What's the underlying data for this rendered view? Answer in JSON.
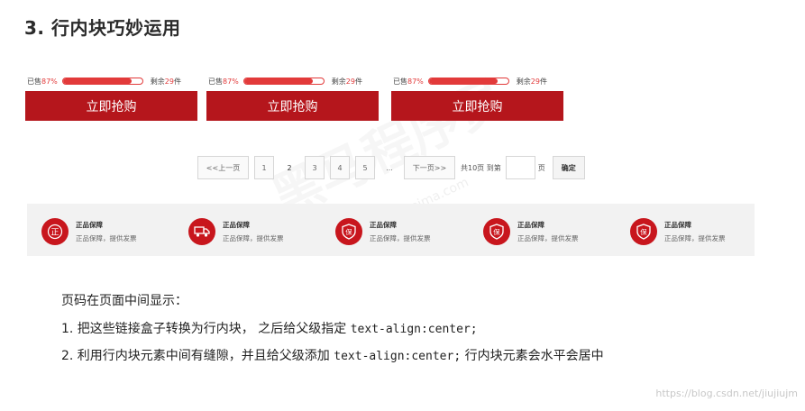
{
  "title": "3. 行内块巧妙运用",
  "cards": [
    {
      "sold_label": "已售",
      "sold_pct": "87%",
      "progress": 0.87,
      "remain_label": "剩余",
      "remain_num": "29",
      "remain_unit": "件",
      "button": "立即抢购"
    },
    {
      "sold_label": "已售",
      "sold_pct": "87%",
      "progress": 0.87,
      "remain_label": "剩余",
      "remain_num": "29",
      "remain_unit": "件",
      "button": "立即抢购"
    },
    {
      "sold_label": "已售",
      "sold_pct": "87%",
      "progress": 0.87,
      "remain_label": "剩余",
      "remain_num": "29",
      "remain_unit": "件",
      "button": "立即抢购"
    }
  ],
  "pagination": {
    "prev": "<<上一页",
    "pages": [
      "1",
      "2",
      "3",
      "4",
      "5"
    ],
    "current": "2",
    "ellipsis": "...",
    "next": "下一页>>",
    "total_text": "共10页 到第",
    "page_unit": "页",
    "confirm": "确定"
  },
  "guarantees": [
    {
      "icon": "zheng-seal-icon",
      "glyph": "正",
      "title": "正品保障",
      "desc": "正品保障，提供发票"
    },
    {
      "icon": "delivery-truck-icon",
      "glyph": "🚚",
      "title": "正品保障",
      "desc": "正品保障，提供发票"
    },
    {
      "icon": "bao-shield-icon",
      "glyph": "保",
      "title": "正品保障",
      "desc": "正品保障，提供发票"
    },
    {
      "icon": "bao-shield-icon",
      "glyph": "保",
      "title": "正品保障",
      "desc": "正品保障，提供发票"
    },
    {
      "icon": "bao-shield-icon",
      "glyph": "保",
      "title": "正品保障",
      "desc": "正品保障，提供发票"
    }
  ],
  "notes": {
    "heading": "页码在页面中间显示：",
    "item1_prefix": "1. 把这些链接盒子转换为行内块， 之后给父级指定 ",
    "item1_code": "text-align:center;",
    "item2_prefix": "2. 利用行内块元素中间有缝隙，并且给父级添加 ",
    "item2_code": "text-align:center;",
    "item2_suffix": " 行内块元素会水平会居中"
  },
  "watermark": "黑马程序员",
  "watermark_url": "www.itheima.com",
  "footer_url": "https://blog.csdn.net/jiujiujm",
  "colors": {
    "brand_red": "#b5161c",
    "progress_red": "#e23a3a",
    "strip_bg": "#f2f2f2"
  }
}
